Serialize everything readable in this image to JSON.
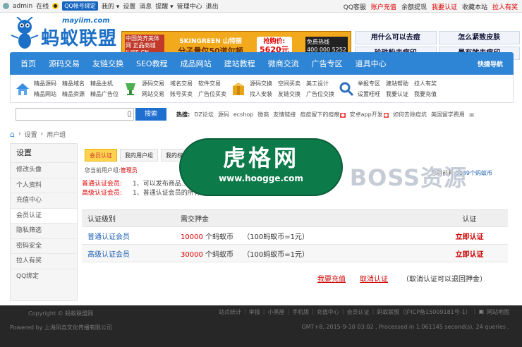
{
  "topbar": {
    "user": "admin",
    "online": "在线",
    "qq_bind": "QQ帐号绑定",
    "mine": "我的",
    "settings": "设置",
    "messages": "消息",
    "remind": "提醒",
    "admin_center": "管理中心",
    "logout": "退出",
    "right": [
      "QQ客服",
      "账户充值",
      "余额提现",
      "我要认证",
      "收藏本站",
      "拉人有奖"
    ]
  },
  "header": {
    "site_url": "mayiim.com",
    "logo_text": "蚂蚁联盟",
    "banner": {
      "left": "中国英齐美体网 正品商城 ILIFE.CN",
      "brand": "SKINGREEN 山特丽",
      "slogan": "分子量仅50道尔顿",
      "price_label": "抢购价:",
      "price": "5620元",
      "phone_label": "免费热线",
      "phone": "400 000 5252"
    },
    "cells": [
      "用什么可以去痘",
      "怎么紧致皮肤",
      "珍珠粉去痘印",
      "最有效去痘印"
    ]
  },
  "nav": {
    "items": [
      "首页",
      "源码交易",
      "友链交换",
      "SEO教程",
      "成品网站",
      "建站教程",
      "微商交流",
      "广告专区",
      "道具中心"
    ],
    "right": "快捷导航"
  },
  "quick": [
    {
      "icon": "house-icon",
      "color": "#3a8ee0",
      "links": [
        "精品源码",
        "精品域名",
        "精品主机",
        "精品网站",
        "精品资源",
        "精品广告位"
      ]
    },
    {
      "icon": "cup-icon",
      "color": "#4caf50",
      "links": [
        "源码交易",
        "域名交易",
        "软件交易",
        "网站交易",
        "账号买卖",
        "广告位买卖"
      ]
    },
    {
      "icon": "box-icon",
      "color": "#e8a317",
      "links": [
        "源码交换",
        "空间买卖",
        "美工设计",
        "找人安装",
        "友链交换",
        "广告位交换"
      ]
    },
    {
      "icon": "magnifier-icon",
      "color": "#2d6fbf",
      "links": [
        "举报专区",
        "建站帮助",
        "拉人有奖",
        "设置旺旺",
        "我要认证",
        "我要充值"
      ]
    }
  ],
  "search": {
    "placeholder": "",
    "button": "搜索",
    "hot_label": "热搜:",
    "hot": [
      "DZ论坛",
      "源码",
      "ecshop",
      "微商",
      "友情链接",
      "痘痘留下的痘痕",
      "安卓app开发",
      "如何去除痘坑",
      "美国留学费用"
    ]
  },
  "breadcrumb": [
    "设置",
    "用户组"
  ],
  "sidebar": {
    "title": "设置",
    "items": [
      "修改头像",
      "个人资料",
      "充值中心",
      "会员认证",
      "隐私筛选",
      "密码安全",
      "拉人有奖",
      "QQ绑定"
    ]
  },
  "main": {
    "tabs": [
      "会员认证",
      "我的用户组",
      "我的权"
    ],
    "group_prefix": "您当前用户组:",
    "group": "管理员",
    "balance_prefix": "您目前有",
    "balance": "5039个蚂蚁币",
    "rules": [
      {
        "level": "普通认证会员:",
        "text": "1、可以发布商品... 3、账号名称全网站显示为红色。"
      },
      {
        "level": "高级认证会员:",
        "text": "1、普通认证会员的所有权限... 3、余额提现一个工作日内到账。"
      }
    ],
    "table": {
      "headers": [
        "认证级别",
        "需交押金",
        "认证"
      ],
      "rows": [
        {
          "level": "普通认证会员",
          "amount": "10000",
          "unit": "个蚂蚁币",
          "rate": "（100蚂蚁币=1元）",
          "action": "立即认证"
        },
        {
          "level": "高级认证会员",
          "amount": "30000",
          "unit": "个蚂蚁币",
          "rate": "（100蚂蚁币=1元）",
          "action": "立即认证"
        }
      ]
    },
    "actions": {
      "recharge": "我要充值",
      "cancel": "取消认证",
      "note": "（取消认证可以退回押金）"
    }
  },
  "watermark": {
    "big": "虎格网",
    "url": "www.hoogge.com",
    "boss": "BOSS资源"
  },
  "footer": {
    "copyright": "Copyright © 蚂蚁联盟网",
    "powered": "Powered by 上海凤垚文化传播有限公司",
    "links": [
      "站点统计",
      "举报",
      "小黑屋",
      "手机版",
      "充值中心",
      "会员认证",
      "蚂蚁联盟（沪ICP备15009181号-1）",
      "网站地图"
    ],
    "stats": "GMT+8, 2015-9-10 03:02 , Processed in 1.061145 second(s), 24 queries ."
  }
}
